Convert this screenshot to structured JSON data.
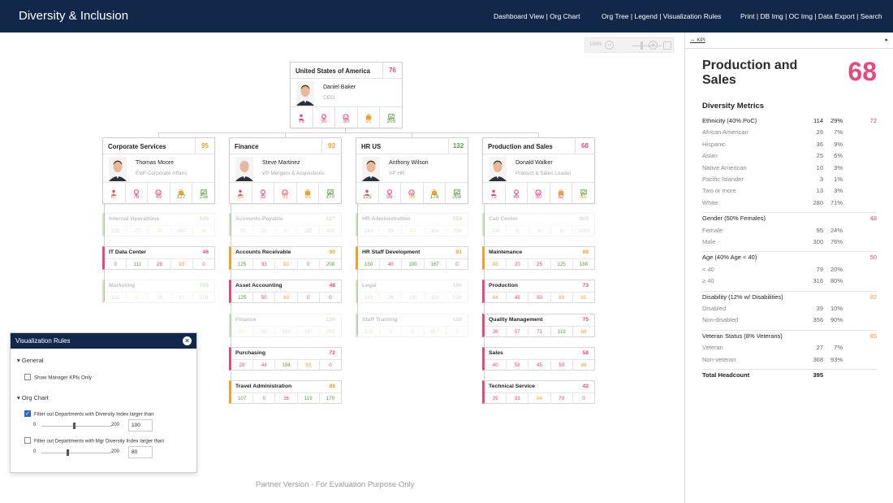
{
  "app": {
    "title": "Diversity & Inclusion"
  },
  "nav": {
    "group1": "Dashboard View | Org Chart",
    "group2": "Org Tree | Legend | Visualization Rules",
    "group3": "Print | DB Img | OC Img | Data Export | Search"
  },
  "zoom": {
    "label": "100%"
  },
  "colors": {
    "header": "#12284a",
    "red": "#e64a7b",
    "orange": "#f0a030",
    "green": "#5ba040"
  },
  "kpi_icons": [
    "person-icon",
    "pin-icon",
    "smile-icon",
    "briefcase-icon",
    "flag-icon"
  ],
  "root": {
    "dept": "United States of America",
    "score": "76",
    "score_color": "#e64a7b",
    "person": "Daniel Baker",
    "title": "CEO",
    "kpis": [
      "76",
      "50",
      "50",
      "91",
      "105"
    ]
  },
  "managers": [
    {
      "dept": "Corporate Services",
      "score": "95",
      "score_color": "#f0a030",
      "person": "Thomas Moore",
      "title": "EVP Corporate Affairs",
      "kpis": [
        "87",
        "78",
        "49",
        "127",
        "136"
      ]
    },
    {
      "dept": "Finance",
      "score": "93",
      "score_color": "#f0a030",
      "person": "Steve Martinez",
      "title": "VP Mergers & Acquisitions",
      "kpis": [
        "80",
        "32",
        "91",
        "95",
        "170"
      ]
    },
    {
      "dept": "HR US",
      "score": "132",
      "score_color": "#5ba040",
      "person": "Anthony Wilson",
      "title": "VP HR",
      "kpis": [
        "125",
        "58",
        "94",
        "174",
        "208"
      ]
    },
    {
      "dept": "Production and Sales",
      "score": "68",
      "score_color": "#e64a7b",
      "person": "Donald Walker",
      "title": "Product & Sales Leader",
      "kpis": [
        "72",
        "48",
        "50",
        "62",
        "85"
      ]
    }
  ],
  "departments": [
    [
      {
        "name": "Internal Operations",
        "score": "105",
        "faded": true,
        "values": [
          "105",
          "77",
          "88",
          "160",
          "96"
        ]
      },
      {
        "name": "IT Data Center",
        "score": "46",
        "faded": false,
        "values": [
          "0",
          "111",
          "28",
          "93",
          "0"
        ]
      },
      {
        "name": "Marketing",
        "score": "105",
        "faded": true,
        "values": [
          "111",
          "97",
          "28",
          "93",
          "278"
        ]
      }
    ],
    [
      {
        "name": "Accounts Payable",
        "score": "127",
        "faded": true,
        "values": [
          "75",
          "50",
          "80",
          "167",
          "200"
        ]
      },
      {
        "name": "Accounts Receivable",
        "score": "90",
        "faded": false,
        "values": [
          "125",
          "33",
          "83",
          "0",
          "208"
        ]
      },
      {
        "name": "Asset Accounting",
        "score": "48",
        "faded": false,
        "values": [
          "125",
          "50",
          "83",
          "0",
          "0"
        ]
      },
      {
        "name": "Finance",
        "score": "139",
        "faded": true,
        "values": [
          "90",
          "50",
          "150",
          "167",
          "250"
        ]
      },
      {
        "name": "Purchasing",
        "score": "72",
        "faded": false,
        "values": [
          "28",
          "44",
          "194",
          "93",
          "0"
        ]
      },
      {
        "name": "Travel Administration",
        "score": "88",
        "faded": false,
        "values": [
          "107",
          "0",
          "36",
          "119",
          "179"
        ]
      }
    ],
    [
      {
        "name": "HR Administration",
        "score": "159",
        "faded": true,
        "values": [
          "143",
          "39",
          "83",
          "104",
          "298"
        ]
      },
      {
        "name": "HR Staff Development",
        "score": "91",
        "faded": false,
        "values": [
          "150",
          "40",
          "100",
          "167",
          "0"
        ]
      },
      {
        "name": "Legal",
        "score": "190",
        "faded": true,
        "values": [
          "143",
          "28",
          "143",
          "119",
          "536"
        ]
      },
      {
        "name": "Staff Training",
        "score": "108",
        "faded": true,
        "values": [
          "125",
          "0",
          "0",
          "417",
          "0"
        ]
      }
    ],
    [
      {
        "name": "Call Center",
        "score": "300",
        "faded": true,
        "values": [
          "100",
          "0",
          "0",
          "0",
          "1200"
        ]
      },
      {
        "name": "Maintenance",
        "score": "89",
        "faded": false,
        "values": [
          "88",
          "20",
          "25",
          "125",
          "188"
        ]
      },
      {
        "name": "Production",
        "score": "73",
        "faded": false,
        "values": [
          "94",
          "48",
          "50",
          "89",
          "81"
        ]
      },
      {
        "name": "Quality Management",
        "score": "75",
        "faded": false,
        "values": [
          "36",
          "57",
          "71",
          "119",
          "89"
        ]
      },
      {
        "name": "Sales",
        "score": "58",
        "faded": false,
        "values": [
          "40",
          "58",
          "45",
          "50",
          "88"
        ]
      },
      {
        "name": "Technical Service",
        "score": "42",
        "faded": false,
        "values": [
          "35",
          "33",
          "84",
          "78",
          "0"
        ]
      }
    ]
  ],
  "vis_rules": {
    "title": "Visualization Rules",
    "close": "✕",
    "general": "General",
    "show_manager_kpis": "Show Manager KPIs Only",
    "show_manager_kpis_checked": false,
    "org_chart": "Org Chart",
    "filter_dept": "Filter out Departments with Diversity Index larger than",
    "filter_dept_checked": true,
    "filter_dept_min": "0",
    "filter_dept_max": "200",
    "filter_dept_value": "100",
    "filter_mgr": "Filter out Departments with Mgr Diversity Index larger than",
    "filter_mgr_checked": false,
    "filter_mgr_min": "0",
    "filter_mgr_max": "200",
    "filter_mgr_value": "80"
  },
  "watermark": "Partner Version - For Evaluation Purpose Only",
  "kpi_panel": {
    "tab": "KPI",
    "title": "Production and Sales",
    "score": "68",
    "metrics_heading": "Diversity Metrics",
    "rows": [
      {
        "kind": "grp",
        "label": "Ethnicity (40% PoC)",
        "count": "114",
        "pct": "29%",
        "score": "72",
        "score_color": "#e64a7b"
      },
      {
        "kind": "sub",
        "label": "African American",
        "count": "26",
        "pct": "7%"
      },
      {
        "kind": "sub",
        "label": "Hispanic",
        "count": "36",
        "pct": "9%"
      },
      {
        "kind": "sub",
        "label": "Asian",
        "count": "25",
        "pct": "6%"
      },
      {
        "kind": "sub",
        "label": "Native American",
        "count": "10",
        "pct": "3%"
      },
      {
        "kind": "sub",
        "label": "Pacific Islander",
        "count": "3",
        "pct": "1%"
      },
      {
        "kind": "sub",
        "label": "Two or more",
        "count": "13",
        "pct": "3%"
      },
      {
        "kind": "sub",
        "label": "White",
        "count": "280",
        "pct": "71%"
      },
      {
        "kind": "grp",
        "label": "Gender (50% Females)",
        "count": "",
        "pct": "",
        "score": "48",
        "score_color": "#e64a7b"
      },
      {
        "kind": "sub",
        "label": "Female",
        "count": "95",
        "pct": "24%"
      },
      {
        "kind": "sub",
        "label": "Male",
        "count": "300",
        "pct": "76%"
      },
      {
        "kind": "grp",
        "label": "Age (40% Age < 40)",
        "count": "",
        "pct": "",
        "score": "50",
        "score_color": "#e64a7b"
      },
      {
        "kind": "sub",
        "label": "< 40",
        "count": "79",
        "pct": "20%"
      },
      {
        "kind": "sub",
        "label": "≥ 40",
        "count": "316",
        "pct": "80%"
      },
      {
        "kind": "grp",
        "label": "Disability (12% w/ Disabilities)",
        "count": "",
        "pct": "",
        "score": "82",
        "score_color": "#f0a030"
      },
      {
        "kind": "sub",
        "label": "Disabled",
        "count": "39",
        "pct": "10%"
      },
      {
        "kind": "sub",
        "label": "Non-disabled",
        "count": "356",
        "pct": "90%"
      },
      {
        "kind": "grp",
        "label": "Veteran Status (8% Veterans)",
        "count": "",
        "pct": "",
        "score": "85",
        "score_color": "#f0a030"
      },
      {
        "kind": "sub",
        "label": "Veteran",
        "count": "27",
        "pct": "7%"
      },
      {
        "kind": "sub",
        "label": "Non-veteran",
        "count": "368",
        "pct": "93%"
      },
      {
        "kind": "tot",
        "label": "Total Headcount",
        "count": "395",
        "pct": ""
      }
    ]
  }
}
